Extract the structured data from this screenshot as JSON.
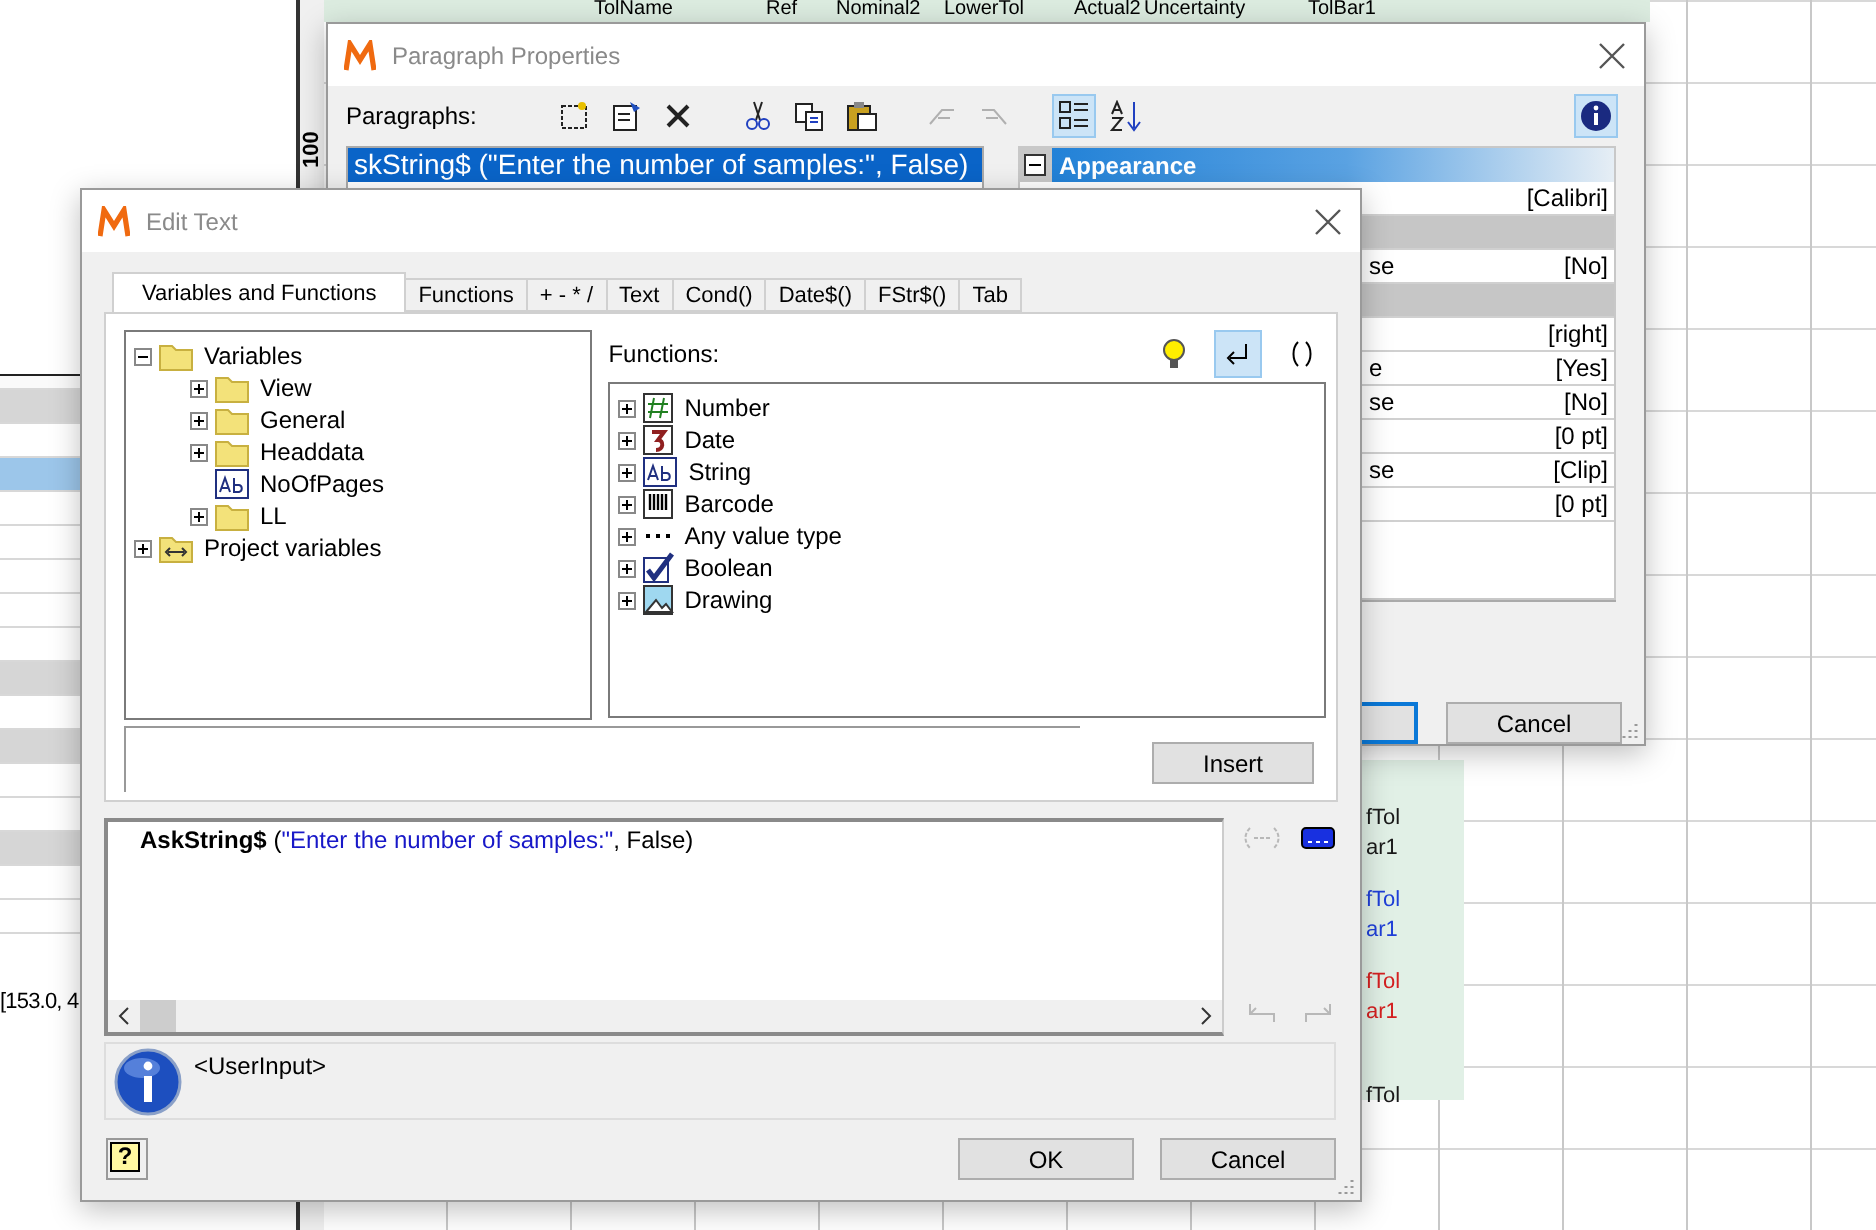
{
  "background": {
    "table_header": [
      "TolName",
      "Ref",
      "Nominal2",
      "LowerTol",
      "Actual2",
      "Uncertainty",
      "TolBar1"
    ],
    "ruler_label": "100",
    "left_rows": [
      {
        "kind": "header",
        "selected": false
      },
      {
        "kind": "shaded",
        "selected": false
      },
      {
        "kind": "plain",
        "selected": false
      },
      {
        "kind": "plain",
        "selected": true
      },
      {
        "kind": "plain",
        "selected": false
      },
      {
        "kind": "plain",
        "selected": false
      },
      {
        "kind": "plain",
        "selected": false
      },
      {
        "kind": "plain",
        "selected": false
      },
      {
        "kind": "plain",
        "selected": false
      },
      {
        "kind": "shaded",
        "selected": false
      },
      {
        "kind": "plain",
        "selected": false
      },
      {
        "kind": "shaded",
        "selected": false
      },
      {
        "kind": "plain",
        "selected": false
      },
      {
        "kind": "plain",
        "selected": false
      },
      {
        "kind": "shaded",
        "selected": false
      },
      {
        "kind": "plain",
        "selected": false
      },
      {
        "kind": "plain",
        "selected": false
      }
    ],
    "coordinates": "[153.0, 4",
    "report_fields": [
      {
        "text": "fTol",
        "color": "#1a1a1a"
      },
      {
        "text": "ar1",
        "color": "#1a1a1a"
      },
      {
        "text": "fTol",
        "color": "#1f3fd8"
      },
      {
        "text": "ar1",
        "color": "#1f3fd8"
      },
      {
        "text": "fTol",
        "color": "#d42020"
      },
      {
        "text": "ar1",
        "color": "#d42020"
      },
      {
        "text": "fTol",
        "color": "#1a1a1a"
      }
    ]
  },
  "paragraph_properties": {
    "title": "Paragraph Properties",
    "paragraphs_label": "Paragraphs:",
    "toolbar": [
      {
        "kind": "new",
        "disabled": false,
        "selected": false
      },
      {
        "kind": "properties",
        "disabled": false,
        "selected": false
      },
      {
        "kind": "delete",
        "disabled": false,
        "selected": false
      },
      {
        "kind": "cut",
        "disabled": false,
        "selected": false
      },
      {
        "kind": "copy",
        "disabled": false,
        "selected": false
      },
      {
        "kind": "paste",
        "disabled": false,
        "selected": false
      },
      {
        "kind": "outdent",
        "disabled": true,
        "selected": false
      },
      {
        "kind": "indent",
        "disabled": true,
        "selected": false
      },
      {
        "kind": "categorized",
        "disabled": false,
        "selected": true
      },
      {
        "kind": "sort",
        "disabled": false,
        "selected": false
      }
    ],
    "paragraphs": [
      {
        "text": "skString$ (\"Enter the number of samples:\", False)",
        "selected": true
      }
    ],
    "category": {
      "label": "Appearance",
      "expanded": true
    },
    "properties": [
      {
        "kind": "value",
        "value": "[Calibri]"
      },
      {
        "kind": "category"
      },
      {
        "kind": "value",
        "label": "se",
        "value": "[No]"
      },
      {
        "kind": "category"
      },
      {
        "kind": "value",
        "value": "[right]"
      },
      {
        "kind": "value",
        "label": "e",
        "value": "[Yes]"
      },
      {
        "kind": "value",
        "label": "se",
        "value": "[No]"
      },
      {
        "kind": "value",
        "value": "[0 pt]"
      },
      {
        "kind": "value",
        "label": "se",
        "value": "[Clip]"
      },
      {
        "kind": "value",
        "value": "[0 pt]"
      }
    ],
    "cancel_button": "Cancel"
  },
  "edit_text": {
    "title": "Edit Text",
    "tabs": [
      {
        "label": "Variables and Functions",
        "selected": true
      },
      {
        "label": "Functions",
        "selected": false
      },
      {
        "label": "+ - * /",
        "selected": false
      },
      {
        "label": "Text",
        "selected": false
      },
      {
        "label": "Cond()",
        "selected": false
      },
      {
        "label": "Date$()",
        "selected": false
      },
      {
        "label": "FStr$()",
        "selected": false
      },
      {
        "label": "Tab",
        "selected": false
      }
    ],
    "variables": [
      {
        "label": "Variables",
        "kind": "folder",
        "expanded": true,
        "children": [
          {
            "label": "View",
            "kind": "folder",
            "expanded": false
          },
          {
            "label": "General",
            "kind": "folder",
            "expanded": false
          },
          {
            "label": "Headdata",
            "kind": "folder",
            "expanded": false
          },
          {
            "label": "NoOfPages",
            "kind": "text"
          },
          {
            "label": "LL",
            "kind": "folder",
            "expanded": false
          }
        ]
      },
      {
        "label": "Project variables",
        "kind": "project",
        "expanded": false
      }
    ],
    "functions_label": "Functions:",
    "function_tools": [
      {
        "kind": "bulb",
        "selected": false
      },
      {
        "kind": "return",
        "selected": true
      },
      {
        "kind": "parens",
        "selected": false
      }
    ],
    "functions": [
      {
        "label": "Number",
        "kind": "number",
        "expanded": false
      },
      {
        "label": "Date",
        "kind": "date",
        "expanded": false
      },
      {
        "label": "String",
        "kind": "string",
        "expanded": false
      },
      {
        "label": "Barcode",
        "kind": "barcode",
        "expanded": false
      },
      {
        "label": "Any value type",
        "kind": "any",
        "expanded": false
      },
      {
        "label": "Boolean",
        "kind": "boolean",
        "expanded": false
      },
      {
        "label": "Drawing",
        "kind": "drawing",
        "expanded": false
      }
    ],
    "insert_button": "Insert",
    "expression": [
      {
        "text": "AskString$",
        "kind": "function"
      },
      {
        "text": " (",
        "kind": "plain"
      },
      {
        "text": "\"Enter the number of samples:\"",
        "kind": "string"
      },
      {
        "text": ", False)",
        "kind": "plain"
      }
    ],
    "editor_tools": [
      {
        "kind": "wrap",
        "disabled": true
      },
      {
        "kind": "dots",
        "disabled": false
      }
    ],
    "history_tools": [
      {
        "kind": "undo",
        "disabled": true
      },
      {
        "kind": "redo",
        "disabled": true
      }
    ],
    "info": "<UserInput>",
    "help_button": "?",
    "buttons": [
      "OK",
      "Cancel"
    ]
  }
}
